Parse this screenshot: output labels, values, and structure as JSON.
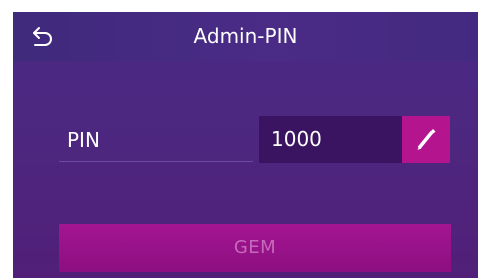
{
  "header": {
    "title": "Admin-PIN",
    "back_icon": "back-arrow-icon"
  },
  "pin": {
    "label": "PIN",
    "value": "1000",
    "edit_icon": "pencil-icon"
  },
  "actions": {
    "save_label": "GEM"
  },
  "colors": {
    "background": "#4c2880",
    "header": "#452a82",
    "field": "#3a1461",
    "accent": "#b5148f",
    "save_button": "#9a138a",
    "save_text_disabled": "#c56abb"
  }
}
